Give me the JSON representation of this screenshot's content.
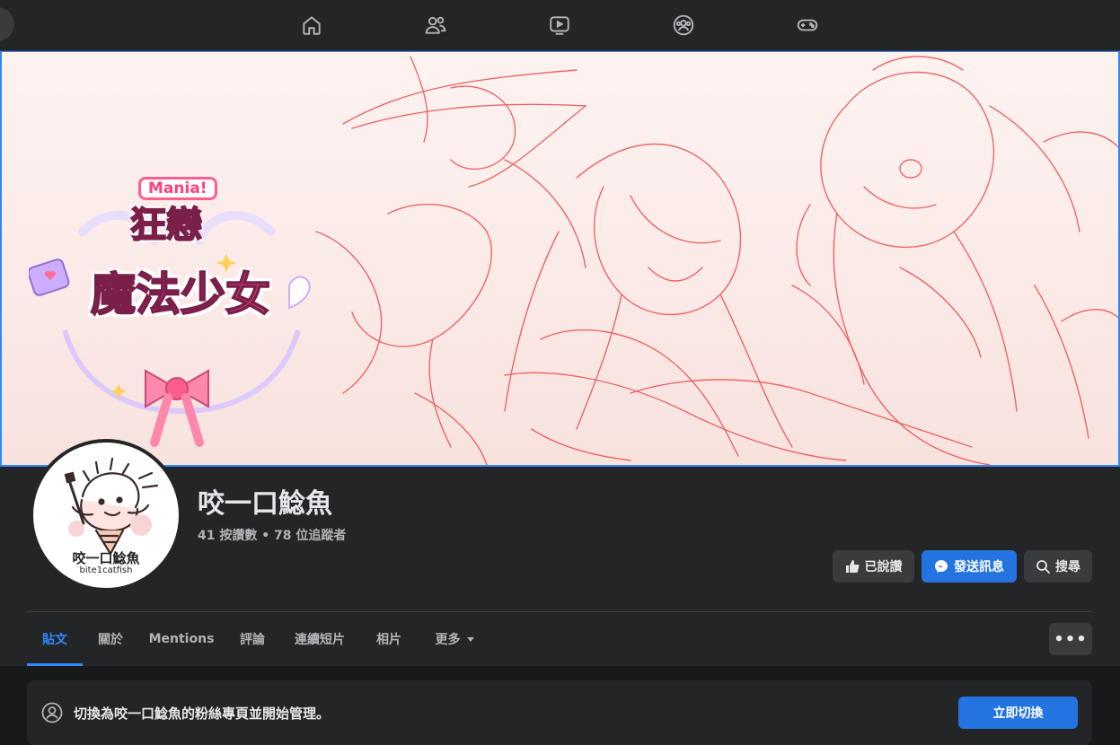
{
  "nav": {
    "icons": [
      "home-icon",
      "friends-icon",
      "watch-icon",
      "groups-icon",
      "gaming-icon"
    ]
  },
  "cover": {
    "logo_badge": "Mania!",
    "logo_line1": "狂戀",
    "logo_line2": "魔法少女"
  },
  "profile": {
    "name": "咬一口鯰魚",
    "stats": "41 按讚數 • 78 位追蹤者",
    "avatar_name": "咬一口鯰魚",
    "avatar_handle": "bite1catfish"
  },
  "actions": {
    "like_label": "已說讚",
    "message_label": "發送訊息",
    "search_label": "搜尋"
  },
  "tabs": [
    {
      "label": "貼文",
      "active": true
    },
    {
      "label": "關於"
    },
    {
      "label": "Mentions"
    },
    {
      "label": "評論"
    },
    {
      "label": "連續短片"
    },
    {
      "label": "相片"
    },
    {
      "label": "更多"
    }
  ],
  "more_menu_label": "•••",
  "switch_banner": {
    "text": "切換為咬一口鯰魚的粉絲專頁並開始管理。",
    "button_label": "立即切換"
  },
  "colors": {
    "accent": "#2d88ff",
    "button_primary": "#2374e1",
    "surface": "#242526",
    "background": "#18191a"
  }
}
